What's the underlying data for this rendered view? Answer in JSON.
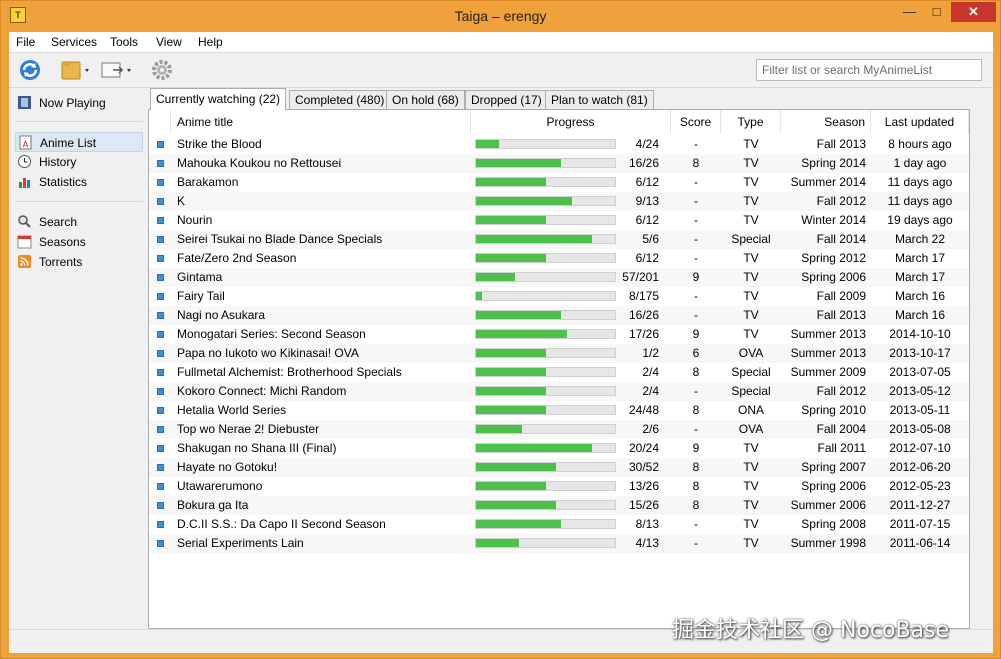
{
  "window": {
    "title": "Taiga – erengy",
    "min_glyph": "—",
    "max_glyph": "□",
    "close_glyph": "✕",
    "icon_glyph": "T"
  },
  "menu": [
    "File",
    "Services",
    "Tools",
    "View",
    "Help"
  ],
  "search": {
    "placeholder": "Filter list or search MyAnimeList"
  },
  "sidebar": {
    "now_playing": "Now Playing",
    "anime_list": "Anime List",
    "history": "History",
    "statistics": "Statistics",
    "search": "Search",
    "seasons": "Seasons",
    "torrents": "Torrents"
  },
  "tabs": [
    {
      "label": "Currently watching (22)",
      "active": true
    },
    {
      "label": "Completed (480)"
    },
    {
      "label": "On hold (68)"
    },
    {
      "label": "Dropped (17)"
    },
    {
      "label": "Plan to watch (81)"
    }
  ],
  "columns": {
    "title": "Anime title",
    "progress": "Progress",
    "score": "Score",
    "type": "Type",
    "season": "Season",
    "updated": "Last updated"
  },
  "colors": {
    "progress_fill": "#4cc24c",
    "status_dot": "#3f8fd8",
    "close_button": "#c7352d"
  },
  "rows": [
    {
      "title": "Strike the Blood",
      "progress": "4/24",
      "watched": 4,
      "total": 24,
      "score": "-",
      "type": "TV",
      "season": "Fall 2013",
      "updated": "8 hours ago"
    },
    {
      "title": "Mahouka Koukou no Rettousei",
      "progress": "16/26",
      "watched": 16,
      "total": 26,
      "score": "8",
      "type": "TV",
      "season": "Spring 2014",
      "updated": "1 day ago"
    },
    {
      "title": "Barakamon",
      "progress": "6/12",
      "watched": 6,
      "total": 12,
      "score": "-",
      "type": "TV",
      "season": "Summer 2014",
      "updated": "11 days ago"
    },
    {
      "title": "K",
      "progress": "9/13",
      "watched": 9,
      "total": 13,
      "score": "-",
      "type": "TV",
      "season": "Fall 2012",
      "updated": "11 days ago"
    },
    {
      "title": "Nourin",
      "progress": "6/12",
      "watched": 6,
      "total": 12,
      "score": "-",
      "type": "TV",
      "season": "Winter 2014",
      "updated": "19 days ago"
    },
    {
      "title": "Seirei Tsukai no Blade Dance Specials",
      "progress": "5/6",
      "watched": 5,
      "total": 6,
      "score": "-",
      "type": "Special",
      "season": "Fall 2014",
      "updated": "March 22"
    },
    {
      "title": "Fate/Zero 2nd Season",
      "progress": "6/12",
      "watched": 6,
      "total": 12,
      "score": "-",
      "type": "TV",
      "season": "Spring 2012",
      "updated": "March 17"
    },
    {
      "title": "Gintama",
      "progress": "57/201",
      "watched": 57,
      "total": 201,
      "score": "9",
      "type": "TV",
      "season": "Spring 2006",
      "updated": "March 17"
    },
    {
      "title": "Fairy Tail",
      "progress": "8/175",
      "watched": 8,
      "total": 175,
      "score": "-",
      "type": "TV",
      "season": "Fall 2009",
      "updated": "March 16"
    },
    {
      "title": "Nagi no Asukara",
      "progress": "16/26",
      "watched": 16,
      "total": 26,
      "score": "-",
      "type": "TV",
      "season": "Fall 2013",
      "updated": "March 16"
    },
    {
      "title": "Monogatari Series: Second Season",
      "progress": "17/26",
      "watched": 17,
      "total": 26,
      "score": "9",
      "type": "TV",
      "season": "Summer 2013",
      "updated": "2014-10-10"
    },
    {
      "title": "Papa no Iukoto wo Kikinasai! OVA",
      "progress": "1/2",
      "watched": 1,
      "total": 2,
      "score": "6",
      "type": "OVA",
      "season": "Summer 2013",
      "updated": "2013-10-17"
    },
    {
      "title": "Fullmetal Alchemist: Brotherhood Specials",
      "progress": "2/4",
      "watched": 2,
      "total": 4,
      "score": "8",
      "type": "Special",
      "season": "Summer 2009",
      "updated": "2013-07-05"
    },
    {
      "title": "Kokoro Connect: Michi Random",
      "progress": "2/4",
      "watched": 2,
      "total": 4,
      "score": "-",
      "type": "Special",
      "season": "Fall 2012",
      "updated": "2013-05-12"
    },
    {
      "title": "Hetalia World Series",
      "progress": "24/48",
      "watched": 24,
      "total": 48,
      "score": "8",
      "type": "ONA",
      "season": "Spring 2010",
      "updated": "2013-05-11"
    },
    {
      "title": "Top wo Nerae 2! Diebuster",
      "progress": "2/6",
      "watched": 2,
      "total": 6,
      "score": "-",
      "type": "OVA",
      "season": "Fall 2004",
      "updated": "2013-05-08"
    },
    {
      "title": "Shakugan no Shana III (Final)",
      "progress": "20/24",
      "watched": 20,
      "total": 24,
      "score": "9",
      "type": "TV",
      "season": "Fall 2011",
      "updated": "2012-07-10"
    },
    {
      "title": "Hayate no Gotoku!",
      "progress": "30/52",
      "watched": 30,
      "total": 52,
      "score": "8",
      "type": "TV",
      "season": "Spring 2007",
      "updated": "2012-06-20"
    },
    {
      "title": "Utawarerumono",
      "progress": "13/26",
      "watched": 13,
      "total": 26,
      "score": "8",
      "type": "TV",
      "season": "Spring 2006",
      "updated": "2012-05-23"
    },
    {
      "title": "Bokura ga Ita",
      "progress": "15/26",
      "watched": 15,
      "total": 26,
      "score": "8",
      "type": "TV",
      "season": "Summer 2006",
      "updated": "2011-12-27"
    },
    {
      "title": "D.C.II S.S.: Da Capo II Second Season",
      "progress": "8/13",
      "watched": 8,
      "total": 13,
      "score": "-",
      "type": "TV",
      "season": "Spring 2008",
      "updated": "2011-07-15"
    },
    {
      "title": "Serial Experiments Lain",
      "progress": "4/13",
      "watched": 4,
      "total": 13,
      "score": "-",
      "type": "TV",
      "season": "Summer 1998",
      "updated": "2011-06-14"
    }
  ],
  "watermark": "掘金技术社区 @ NocoBase"
}
